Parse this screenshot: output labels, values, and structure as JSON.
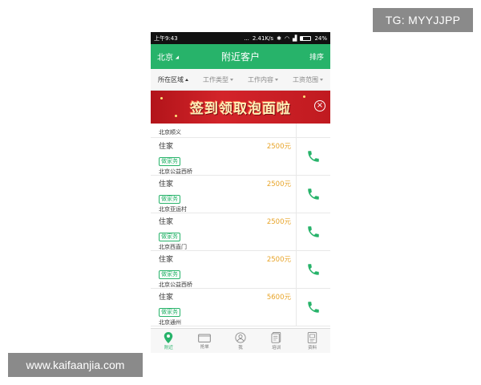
{
  "watermarks": {
    "top": "TG: MYYJJPP",
    "bottom": "www.kaifaanjia.com"
  },
  "status_bar": {
    "time": "上午9:43",
    "dots": "...",
    "speed": "2.41K/s",
    "battery": "24%"
  },
  "header": {
    "city": "北京",
    "title": "附近客户",
    "sort": "排序"
  },
  "filters": [
    {
      "label": "所在区域",
      "active": true
    },
    {
      "label": "工作类型",
      "active": false
    },
    {
      "label": "工作内容",
      "active": false
    },
    {
      "label": "工资范围",
      "active": false
    }
  ],
  "banner": {
    "text": "签到领取泡面啦",
    "close": "×"
  },
  "partial_row": {
    "area": "北京顺义"
  },
  "rows": [
    {
      "title": "住家",
      "price": "2500元",
      "tag": "做家务",
      "area": "北京公益西桥"
    },
    {
      "title": "住家",
      "price": "2500元",
      "tag": "做家务",
      "area": "北京亚运村"
    },
    {
      "title": "住家",
      "price": "2500元",
      "tag": "做家务",
      "area": "北京西直门"
    },
    {
      "title": "住家",
      "price": "2500元",
      "tag": "做家务",
      "area": "北京公益西桥"
    },
    {
      "title": "住家",
      "price": "5600元",
      "tag": "做家务",
      "area": "北京通州"
    }
  ],
  "tabs": [
    {
      "label": "附近",
      "icon": "location-pin-icon",
      "active": true
    },
    {
      "label": "抢单",
      "icon": "folder-icon",
      "active": false
    },
    {
      "label": "我",
      "icon": "user-icon",
      "active": false
    },
    {
      "label": "培训",
      "icon": "book-icon",
      "active": false
    },
    {
      "label": "资料",
      "icon": "document-icon",
      "active": false
    }
  ],
  "colors": {
    "primary": "#27b36a",
    "price": "#e8a428",
    "banner": "#c8202a"
  }
}
